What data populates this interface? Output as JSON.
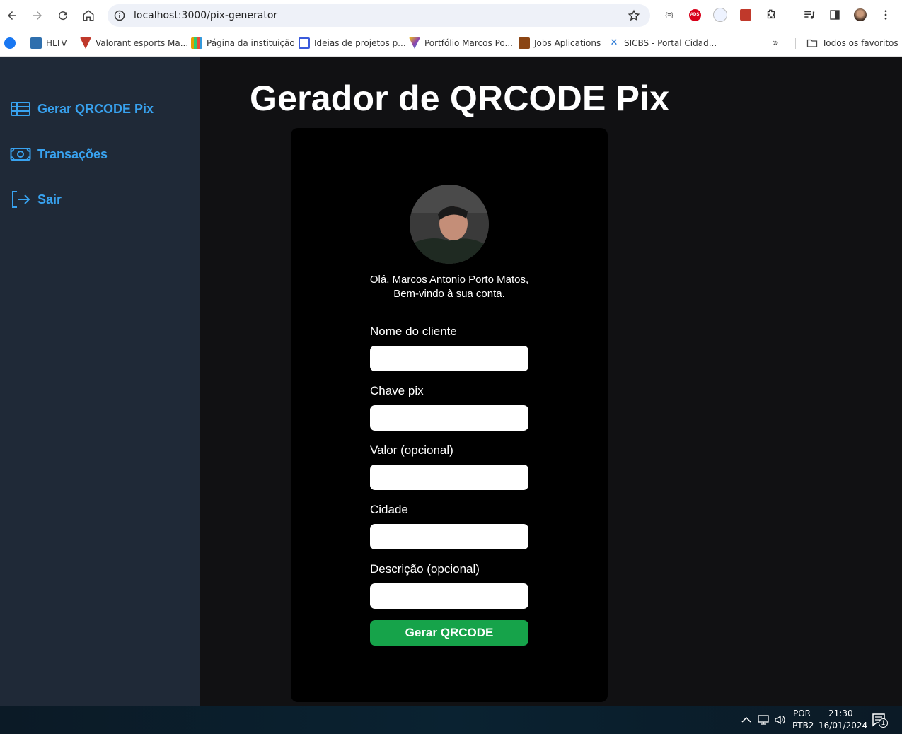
{
  "browser": {
    "url": "localhost:3000/pix-generator",
    "bookmarks": [
      {
        "label": "HLTV",
        "color": "#2f6fad"
      },
      {
        "label": "Valorant esports Ma...",
        "color": "#c0392b"
      },
      {
        "label": "Página da instituição",
        "color": "#e6a000"
      },
      {
        "label": "Ideias de projetos p...",
        "color": "#3b5bdb"
      },
      {
        "label": "Portfólio Marcos Po...",
        "color": "#8e44ad"
      },
      {
        "label": "Jobs Aplications",
        "color": "#8b4513"
      },
      {
        "label": "SICBS - Portal Cidad...",
        "color": "#1c6fd1"
      }
    ],
    "all_favorites": "Todos os favoritos",
    "ext_json_label": "{≡}",
    "ext_ads_label": "ADS"
  },
  "sidebar": {
    "items": [
      {
        "label": "Gerar QRCODE Pix",
        "icon": "table-icon"
      },
      {
        "label": "Transações",
        "icon": "money-icon"
      },
      {
        "label": "Sair",
        "icon": "logout-icon"
      }
    ]
  },
  "main": {
    "title": "Gerador de QRCODE Pix",
    "greeting_line1": "Olá, Marcos Antonio Porto Matos,",
    "greeting_line2": "Bem-vindo à sua conta.",
    "fields": [
      {
        "label": "Nome do cliente",
        "value": ""
      },
      {
        "label": "Chave pix",
        "value": ""
      },
      {
        "label": "Valor (opcional)",
        "value": ""
      },
      {
        "label": "Cidade",
        "value": ""
      },
      {
        "label": "Descrição (opcional)",
        "value": ""
      }
    ],
    "submit_label": "Gerar QRCODE"
  },
  "taskbar": {
    "lang_top": "POR",
    "lang_bottom": "PTB2",
    "time": "21:30",
    "date": "16/01/2024",
    "notifications": "1"
  },
  "colors": {
    "accent": "#38a2ef",
    "sidebar_bg": "#1f2937",
    "button_green": "#16a34a"
  }
}
